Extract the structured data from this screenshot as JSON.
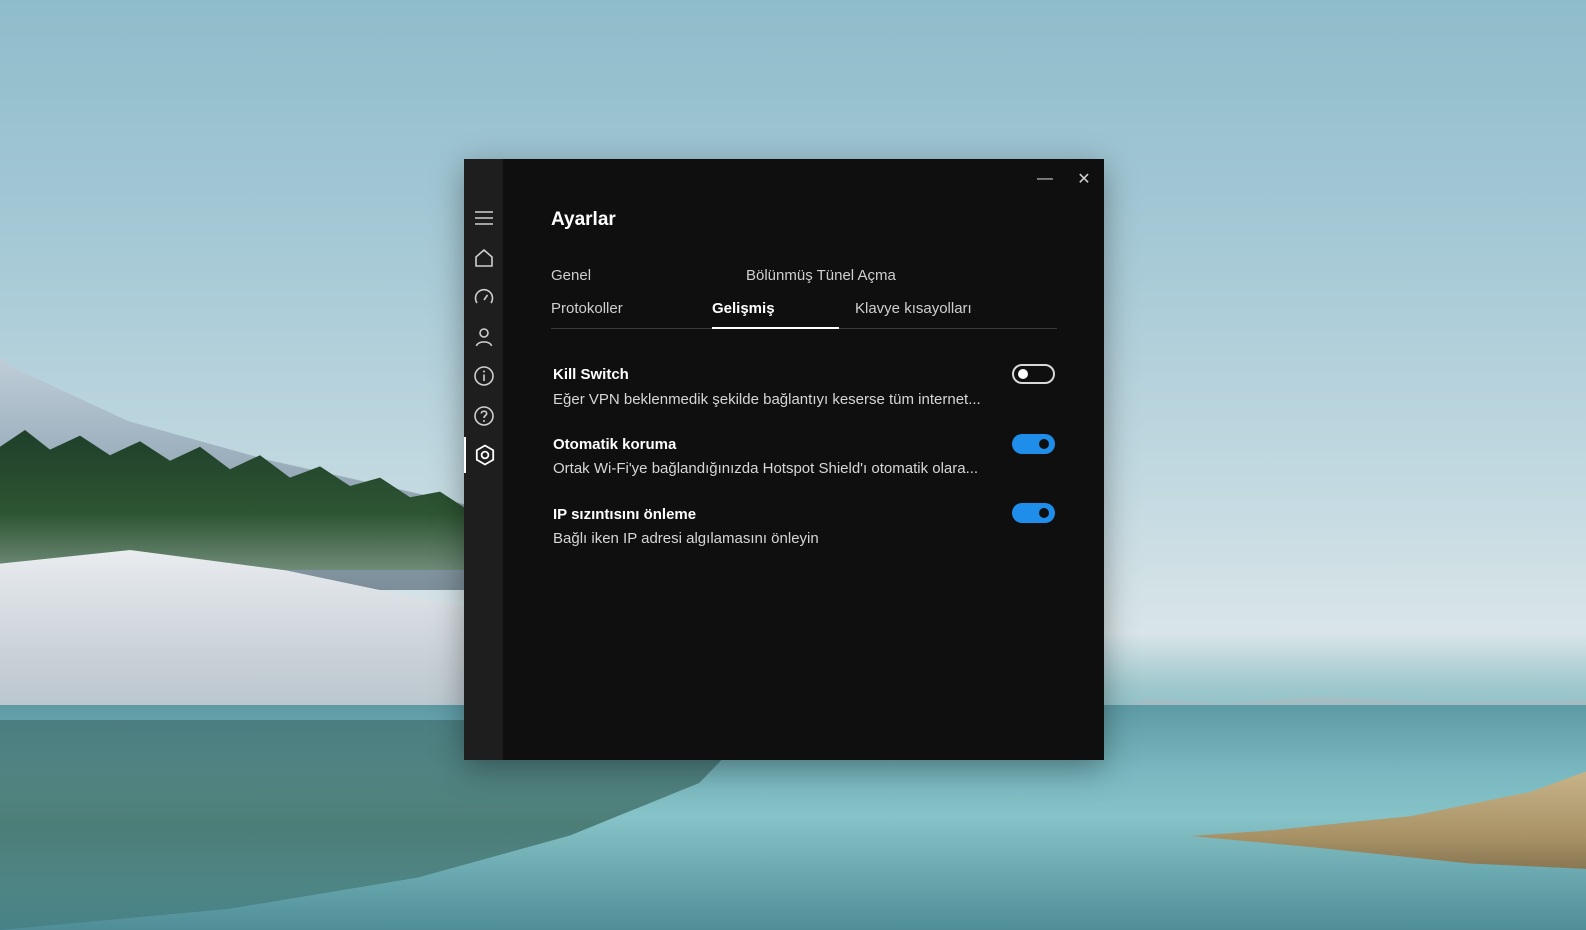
{
  "window": {
    "title": "Ayarlar",
    "minimize_glyph": "—",
    "close_glyph": "✕"
  },
  "sidebar": {
    "items": [
      {
        "icon": "hamburger-menu-icon",
        "active": false
      },
      {
        "icon": "home-icon",
        "active": false
      },
      {
        "icon": "speedometer-icon",
        "active": false
      },
      {
        "icon": "account-icon",
        "active": false
      },
      {
        "icon": "info-icon",
        "active": false
      },
      {
        "icon": "help-icon",
        "active": false
      },
      {
        "icon": "settings-icon",
        "active": true
      }
    ]
  },
  "tabs": [
    {
      "label": "Genel",
      "active": false
    },
    {
      "label": "Bölünmüş Tünel Açma",
      "active": false
    },
    {
      "label": "Protokoller",
      "active": false
    },
    {
      "label": "Gelişmiş",
      "active": true
    },
    {
      "label": "Klavye kısayolları",
      "active": false
    }
  ],
  "settings": [
    {
      "title": "Kill Switch",
      "description": "Eğer VPN beklenmedik şekilde bağlantıyı keserse tüm internet...",
      "enabled": false
    },
    {
      "title": "Otomatik koruma",
      "description": "Ortak Wi-Fi'ye bağlandığınızda Hotspot Shield'ı otomatik olara...",
      "enabled": true
    },
    {
      "title": "IP sızıntısını önleme",
      "description": "Bağlı iken IP adresi algılamasını önleyin",
      "enabled": true
    }
  ],
  "colors": {
    "window_bg": "#0f0f10",
    "sidebar_bg": "#1e1e1f",
    "toggle_on": "#1f8eea",
    "text_primary": "#ffffff",
    "text_secondary": "#d6d6d6"
  }
}
